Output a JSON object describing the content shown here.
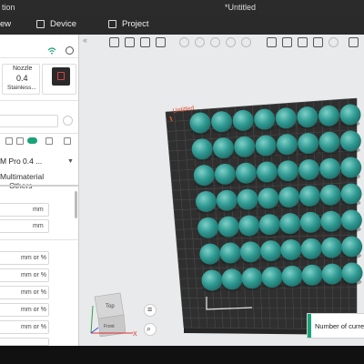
{
  "window": {
    "left_label": "tion",
    "title": "*Untitled"
  },
  "tabs": [
    {
      "label": "ew"
    },
    {
      "label": "Device"
    },
    {
      "label": "Project"
    }
  ],
  "left_panel": {
    "nozzle": {
      "label": "Nozzle",
      "value": "0.4",
      "material": "Stainless..."
    },
    "preset_name": "M Pro 0.4 ...",
    "subtabs": {
      "multimaterial": "Multimaterial",
      "others": "Others"
    },
    "units": {
      "mm": "mm",
      "mm_or_pct": "mm or %"
    }
  },
  "viewport": {
    "plate_label": "Untitled",
    "nav_cube": {
      "top": "Top",
      "front": "Front"
    },
    "axis_x": "X",
    "sphere_color": "#2f9a92",
    "plate_color": "#2f2f2f"
  },
  "tooltip": {
    "text": "Number of curre"
  },
  "colors": {
    "accent": "#1aa37a"
  }
}
